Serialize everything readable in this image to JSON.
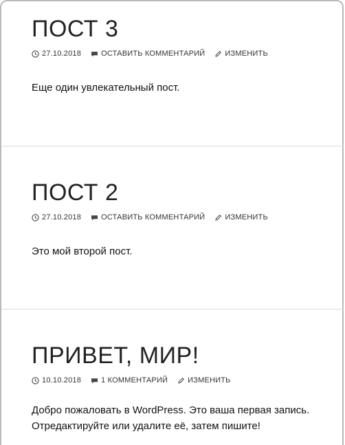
{
  "posts": [
    {
      "title": "ПОСТ 3",
      "date": "27.10.2018",
      "comments": "ОСТАВИТЬ КОММЕНТАРИЙ",
      "edit": "ИЗМЕНИТЬ",
      "content_lines": [
        "Еще один увлекательный пост."
      ]
    },
    {
      "title": "ПОСТ 2",
      "date": "27.10.2018",
      "comments": "ОСТАВИТЬ КОММЕНТАРИЙ",
      "edit": "ИЗМЕНИТЬ",
      "content_lines": [
        "Это мой второй пост."
      ]
    },
    {
      "title": "ПРИВЕТ, МИР!",
      "date": "10.10.2018",
      "comments": "1 КОММЕНТАРИЙ",
      "edit": "ИЗМЕНИТЬ",
      "content_lines": [
        "Добро пожаловать в WordPress. Это ваша первая запись.",
        "Отредактируйте или удалите её, затем пишите!"
      ]
    }
  ],
  "icons": {
    "date": "clock-icon",
    "comments": "comment-bubble-icon",
    "edit": "pencil-icon"
  }
}
